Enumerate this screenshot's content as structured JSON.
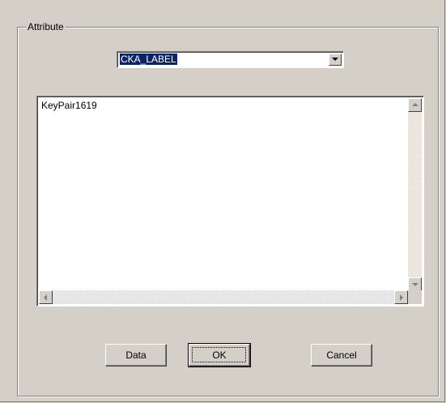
{
  "dialog": {
    "group_label": "Attribute",
    "attribute_select": {
      "selected": "CKA_LABEL"
    },
    "value_text": "KeyPair1619",
    "buttons": {
      "data": "Data",
      "ok": "OK",
      "cancel": "Cancel"
    }
  }
}
